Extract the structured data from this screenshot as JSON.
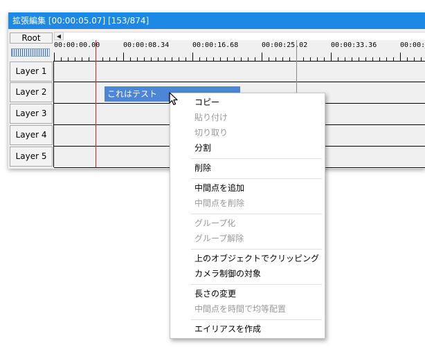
{
  "window": {
    "title": "拡張編集 [00:00:05.07] [153/874]",
    "root_label": "Root"
  },
  "ruler": {
    "time_labels": [
      "00:00:00.00",
      "00:00:08.34",
      "00:00:16.68",
      "00:00:25.02",
      "00:00:33.36",
      "00:00:4"
    ]
  },
  "layers": [
    "Layer 1",
    "Layer 2",
    "Layer 3",
    "Layer 4",
    "Layer 5"
  ],
  "clip": {
    "label": "これはテスト"
  },
  "context_menu": {
    "items": [
      {
        "label": "コピー",
        "enabled": true
      },
      {
        "label": "貼り付け",
        "enabled": false
      },
      {
        "label": "切り取り",
        "enabled": false
      },
      {
        "label": "分割",
        "enabled": true
      },
      {
        "label": "削除",
        "enabled": true
      },
      {
        "label": "中間点を追加",
        "enabled": true
      },
      {
        "label": "中間点を削除",
        "enabled": false
      },
      {
        "label": "グループ化",
        "enabled": false
      },
      {
        "label": "グループ解除",
        "enabled": false
      },
      {
        "label": "上のオブジェクトでクリッピング",
        "enabled": true
      },
      {
        "label": "カメラ制御の対象",
        "enabled": true
      },
      {
        "label": "長さの変更",
        "enabled": true
      },
      {
        "label": "中間点を時間で均等配置",
        "enabled": false
      },
      {
        "label": "エイリアスを作成",
        "enabled": true
      }
    ]
  },
  "colors": {
    "titlebar": "#1e88e5",
    "clip": "#4d86d6",
    "playhead": "#c62828"
  }
}
